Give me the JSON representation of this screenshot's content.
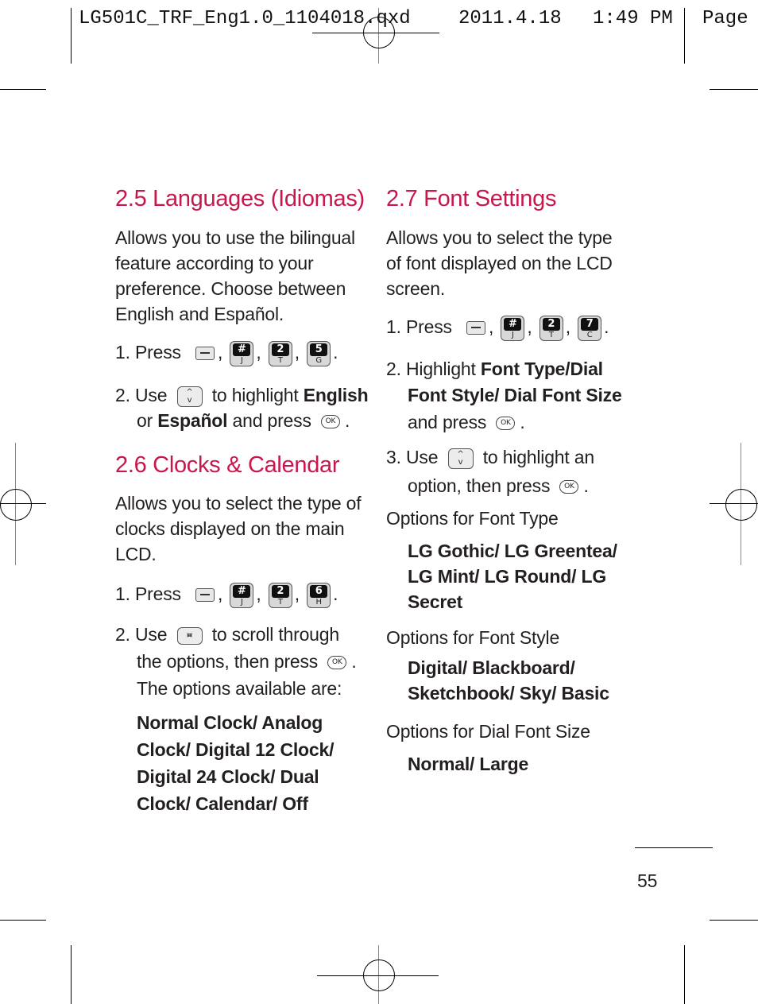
{
  "slug": {
    "filename": "LG501C_TRF_Eng1.0_1104018.qxd",
    "date": "2011.4.18",
    "time": "1:49 PM",
    "page_label": "Page"
  },
  "left": {
    "s25": {
      "title": "2.5 Languages (Idiomas)",
      "body": [
        "Allows you to use the bilingual",
        "feature according to your",
        "preference. Choose between",
        "English and Español."
      ],
      "step1": {
        "num": "1.",
        "text": "Press",
        "keys": [
          {
            "top": "#",
            "bottom": "J"
          },
          {
            "top": "2",
            "bottom": "T"
          },
          {
            "top": "5",
            "bottom": "G"
          }
        ]
      },
      "step2": {
        "num": "2.",
        "pre": "Use",
        "mid": "to highlight",
        "bold1": "English",
        "line2_pre": "or",
        "bold2": "Español",
        "line2_post": "and press"
      }
    },
    "s26": {
      "title": "2.6 Clocks & Calendar",
      "body": [
        "Allows you to select the type of",
        "clocks displayed on the main",
        "LCD."
      ],
      "step1": {
        "num": "1.",
        "text": "Press",
        "keys": [
          {
            "top": "#",
            "bottom": "J"
          },
          {
            "top": "2",
            "bottom": "T"
          },
          {
            "top": "6",
            "bottom": "H"
          }
        ]
      },
      "step2": {
        "num": "2.",
        "pre": "Use",
        "post": "to scroll through",
        "line2": "the options, then press",
        "line3": "The options available are:"
      },
      "options": [
        "Normal Clock/ Analog",
        "Clock/ Digital 12 Clock/",
        "Digital 24 Clock/ Dual",
        "Clock/ Calendar/ Off"
      ]
    }
  },
  "right": {
    "s27": {
      "title": "2.7 Font Settings",
      "body": [
        "Allows you to select the type",
        "of font displayed on the LCD",
        "screen."
      ],
      "step1": {
        "num": "1.",
        "text": "Press",
        "keys": [
          {
            "top": "#",
            "bottom": "J"
          },
          {
            "top": "2",
            "bottom": "T"
          },
          {
            "top": "7",
            "bottom": "C"
          }
        ]
      },
      "step2": {
        "num": "2.",
        "pre": "Highlight",
        "bold1": "Font Type/Dial",
        "bold2": "Font Style/ Dial Font Size",
        "line3": "and press"
      },
      "step3": {
        "num": "3.",
        "pre": "Use",
        "post": "to highlight an",
        "line2": "option, then press"
      },
      "font_type": {
        "label": "Options for Font Type",
        "values": [
          "LG Gothic/ LG Greentea/",
          "LG Mint/ LG Round/ LG",
          "Secret"
        ]
      },
      "font_style": {
        "label": "Options for Font Style",
        "values": [
          "Digital/ Blackboard/",
          "Sketchbook/ Sky/ Basic"
        ]
      },
      "font_size": {
        "label": "Options for Dial Font Size",
        "values": [
          "Normal/ Large"
        ]
      }
    }
  },
  "icons": {
    "ok_label": "OK",
    "up": "^",
    "down": "v",
    "left": "<",
    "right": ">"
  },
  "page_number": "55"
}
